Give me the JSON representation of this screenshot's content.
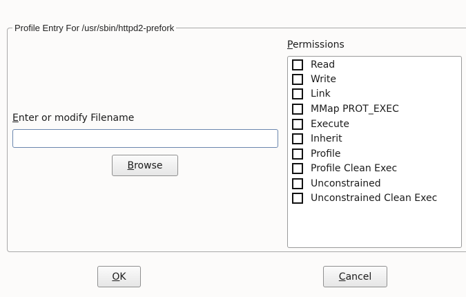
{
  "profile_entry": {
    "legend": "Profile Entry For /usr/sbin/httpd2-prefork"
  },
  "filename": {
    "label_mnemonic": "E",
    "label_rest": "nter or modify Filename",
    "value": "",
    "placeholder": ""
  },
  "browse_button": {
    "mnemonic": "B",
    "rest": "rowse"
  },
  "permissions": {
    "label_mnemonic": "P",
    "label_rest": "ermissions",
    "items": [
      {
        "label": "Read",
        "checked": false
      },
      {
        "label": "Write",
        "checked": false
      },
      {
        "label": "Link",
        "checked": false
      },
      {
        "label": "MMap PROT_EXEC",
        "checked": false
      },
      {
        "label": "Execute",
        "checked": false
      },
      {
        "label": "Inherit",
        "checked": false
      },
      {
        "label": "Profile",
        "checked": false
      },
      {
        "label": "Profile Clean Exec",
        "checked": false
      },
      {
        "label": "Unconstrained",
        "checked": false
      },
      {
        "label": "Unconstrained Clean Exec",
        "checked": false
      }
    ]
  },
  "ok_button": {
    "mnemonic": "O",
    "rest": "K"
  },
  "cancel_button": {
    "mnemonic": "C",
    "rest": "ancel"
  }
}
